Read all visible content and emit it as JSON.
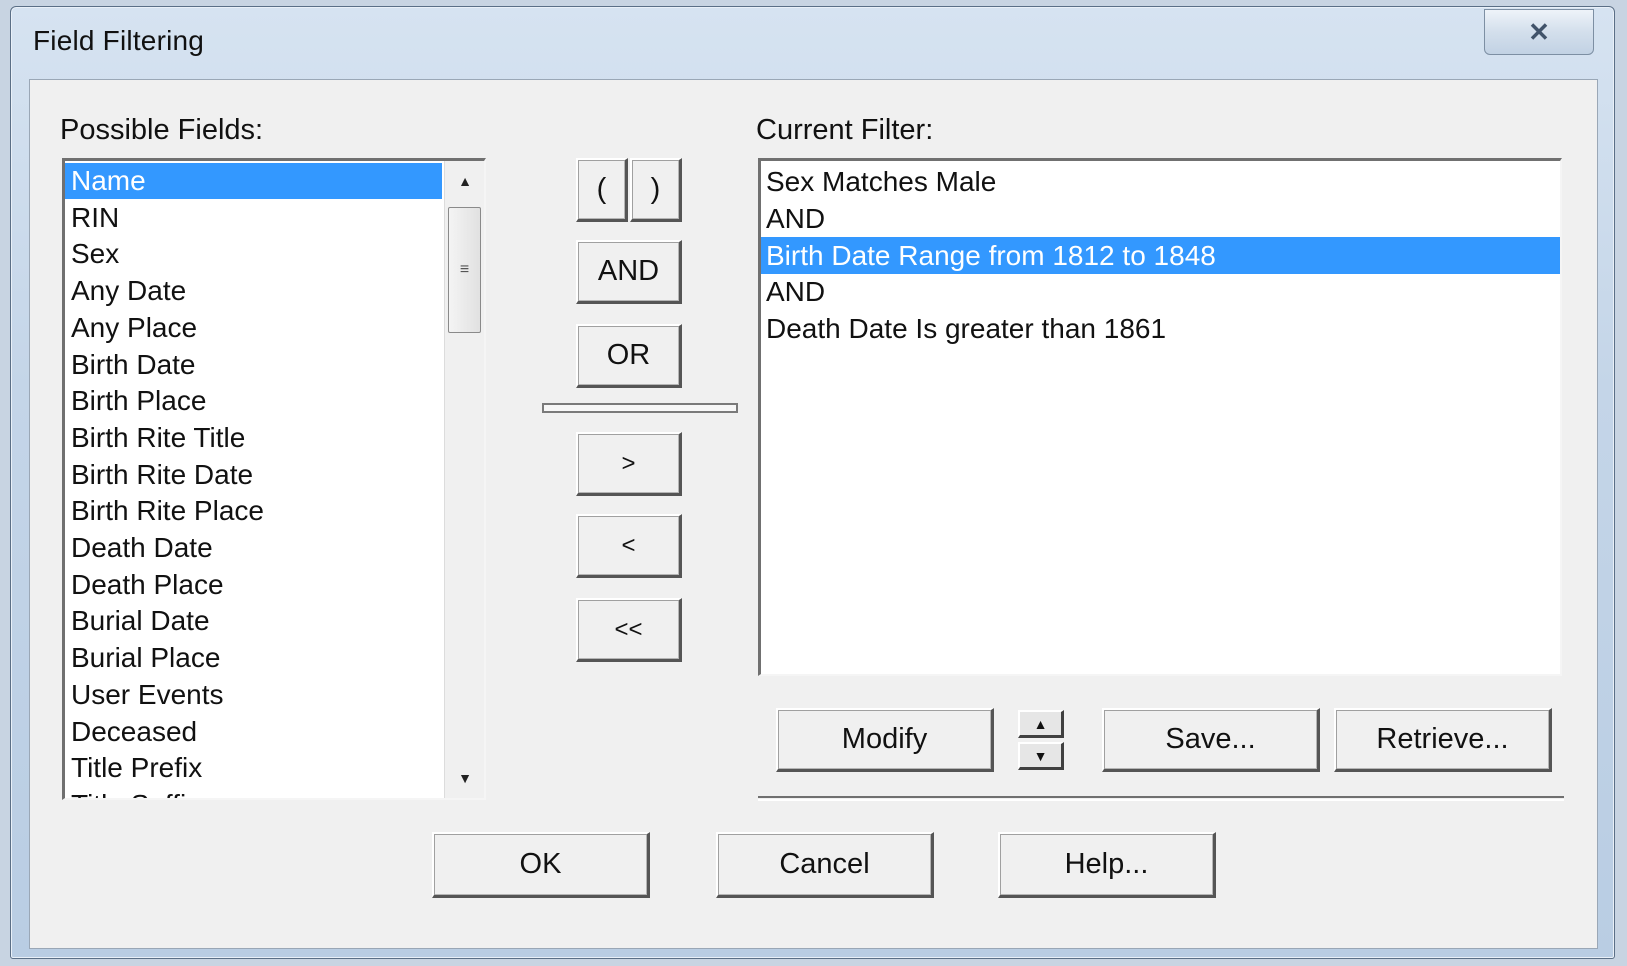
{
  "window": {
    "title": "Field Filtering",
    "close_glyph": "✕"
  },
  "possible_fields": {
    "label": "Possible Fields:",
    "items": [
      {
        "label": "Name",
        "selected": true
      },
      {
        "label": "RIN"
      },
      {
        "label": "Sex"
      },
      {
        "label": "Any Date"
      },
      {
        "label": "Any Place"
      },
      {
        "label": "Birth Date"
      },
      {
        "label": "Birth Place"
      },
      {
        "label": "Birth Rite Title"
      },
      {
        "label": "Birth Rite Date"
      },
      {
        "label": "Birth Rite Place"
      },
      {
        "label": "Death Date"
      },
      {
        "label": "Death Place"
      },
      {
        "label": "Burial Date"
      },
      {
        "label": "Burial Place"
      },
      {
        "label": "User Events"
      },
      {
        "label": "Deceased"
      },
      {
        "label": "Title Prefix"
      },
      {
        "label": "Title Suffix"
      }
    ],
    "scroll_up_glyph": "▲",
    "scroll_down_glyph": "▼",
    "thumb_grip_glyph": "≡"
  },
  "operators": {
    "open_paren": "(",
    "close_paren": ")",
    "and": "AND",
    "or": "OR",
    "add": ">",
    "remove": "<",
    "remove_all": "<<"
  },
  "current_filter": {
    "label": "Current Filter:",
    "lines": [
      {
        "text": "Sex Matches Male"
      },
      {
        "text": "AND"
      },
      {
        "text": "Birth Date Range from 1812 to 1848",
        "selected": true
      },
      {
        "text": "AND"
      },
      {
        "text": "Death Date Is greater than 1861"
      }
    ]
  },
  "filter_actions": {
    "modify": "Modify",
    "move_up_glyph": "▲",
    "move_down_glyph": "▼",
    "save": "Save...",
    "retrieve": "Retrieve..."
  },
  "dialog_buttons": {
    "ok": "OK",
    "cancel": "Cancel",
    "help": "Help..."
  }
}
